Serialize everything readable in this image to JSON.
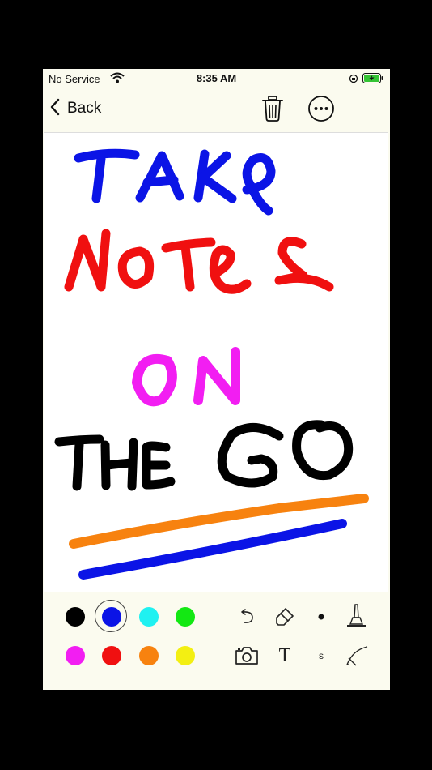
{
  "status_bar": {
    "carrier": "No Service",
    "time": "8:35 AM"
  },
  "nav": {
    "back_label": "Back"
  },
  "canvas": {
    "strokes": [
      {
        "color": "#0b14e6",
        "word": "TAKE"
      },
      {
        "color": "#f01010",
        "word": "Notes"
      },
      {
        "color": "#f21ef2",
        "word": "ON"
      },
      {
        "color": "#000000",
        "word": "THE GO"
      },
      {
        "color": "#f7820f",
        "word": "underline"
      },
      {
        "color": "#0b14e6",
        "word": "underline"
      }
    ]
  },
  "toolbar": {
    "colors": [
      {
        "name": "black",
        "hex": "#000000",
        "selected": false
      },
      {
        "name": "blue",
        "hex": "#0b14e6",
        "selected": true
      },
      {
        "name": "cyan",
        "hex": "#1ff1f1",
        "selected": false
      },
      {
        "name": "green",
        "hex": "#13e813",
        "selected": false
      },
      {
        "name": "magenta",
        "hex": "#f21ef2",
        "selected": false
      },
      {
        "name": "red",
        "hex": "#f01010",
        "selected": false
      },
      {
        "name": "orange",
        "hex": "#f7820f",
        "selected": false
      },
      {
        "name": "yellow",
        "hex": "#f3ef12",
        "selected": false
      }
    ],
    "tools": [
      "undo-icon",
      "eraser-icon",
      "brush-size-dot-icon",
      "marker-icon",
      "camera-icon",
      "text-icon",
      "size-small-label",
      "pen-icon"
    ],
    "text_tool_label": "T",
    "size_label": "s"
  }
}
